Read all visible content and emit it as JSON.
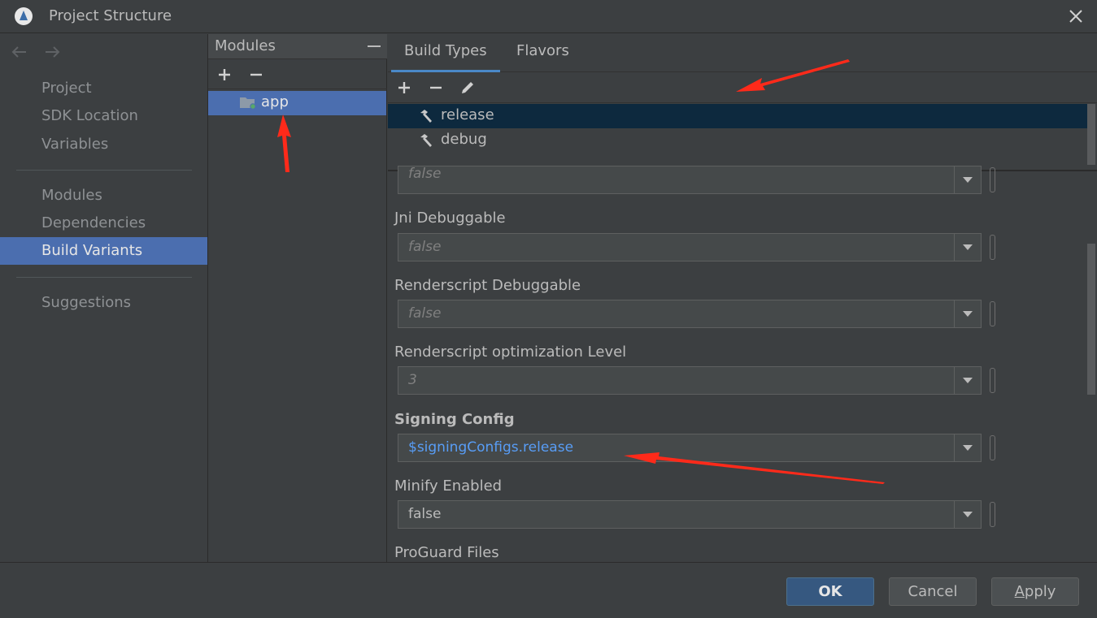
{
  "window": {
    "title": "Project Structure"
  },
  "nav": {
    "items": [
      {
        "label": "Project"
      },
      {
        "label": "SDK Location"
      },
      {
        "label": "Variables"
      },
      {
        "label": "Modules"
      },
      {
        "label": "Dependencies"
      },
      {
        "label": "Build Variants",
        "selected": true
      },
      {
        "label": "Suggestions"
      }
    ]
  },
  "modules": {
    "title": "Modules",
    "items": [
      {
        "label": "app",
        "selected": true
      }
    ]
  },
  "tabs": [
    {
      "label": "Build Types",
      "active": true
    },
    {
      "label": "Flavors"
    }
  ],
  "build_types": [
    {
      "label": "release",
      "selected": true
    },
    {
      "label": "debug"
    }
  ],
  "properties": {
    "top_value": "false",
    "jni": {
      "label": "Jni Debuggable",
      "value": "false"
    },
    "renderscript_debug": {
      "label": "Renderscript Debuggable",
      "value": "false"
    },
    "renderscript_opt": {
      "label": "Renderscript optimization Level",
      "value": "3"
    },
    "signing": {
      "label": "Signing Config",
      "value": "$signingConfigs.release"
    },
    "minify": {
      "label": "Minify Enabled",
      "value": "false"
    },
    "proguard": {
      "label": "ProGuard Files"
    }
  },
  "buttons": {
    "ok": "OK",
    "cancel": "Cancel",
    "apply": "Apply"
  },
  "colors": {
    "accent": "#4b6eaf",
    "link": "#589df6",
    "annotation": "#ff2a1a"
  }
}
